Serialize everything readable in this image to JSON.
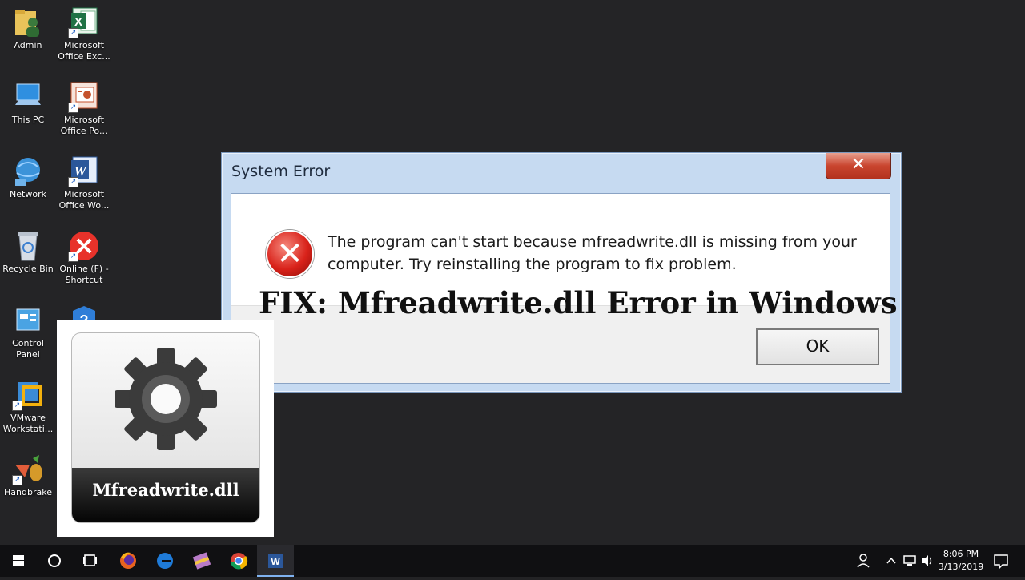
{
  "desktop": {
    "icons": [
      {
        "label": "Admin",
        "icon": "user-folder-icon"
      },
      {
        "label": "Microsoft Office Exc...",
        "icon": "excel-icon"
      },
      {
        "label": "This PC",
        "icon": "computer-icon"
      },
      {
        "label": "Microsoft Office Po...",
        "icon": "powerpoint-icon"
      },
      {
        "label": "Network",
        "icon": "network-icon"
      },
      {
        "label": "Microsoft Office Wo...",
        "icon": "word-icon"
      },
      {
        "label": "Recycle Bin",
        "icon": "recycle-bin-icon"
      },
      {
        "label": "Online (F) - Shortcut",
        "icon": "error-drive-icon"
      },
      {
        "label": "Control Panel",
        "icon": "control-panel-icon"
      },
      {
        "label": "VMware Workstati...",
        "icon": "vmware-icon"
      },
      {
        "label": "Handbrake",
        "icon": "handbrake-icon"
      }
    ]
  },
  "dialog": {
    "title": "System Error",
    "close_glyph": "✕",
    "message": "The program can't start because mfreadwrite.dll is missing from your computer. Try reinstalling the program to fix problem.",
    "ok_label": "OK"
  },
  "overlay": {
    "headline": "FIX: Mfreadwrite.dll Error in Windows",
    "card_label": "Mfreadwrite.dll"
  },
  "taskbar": {
    "apps": [
      "start-icon",
      "cortana-icon",
      "task-view-icon",
      "firefox-icon",
      "edge-icon",
      "winrar-icon",
      "chrome-icon",
      "word-icon"
    ],
    "time": "8:06 PM",
    "date": "3/13/2019"
  },
  "colors": {
    "desktop_bg": "#242426",
    "dialog_frame": "#c6daf1",
    "close_button": "#c9452f",
    "error_red": "#d9221a"
  }
}
